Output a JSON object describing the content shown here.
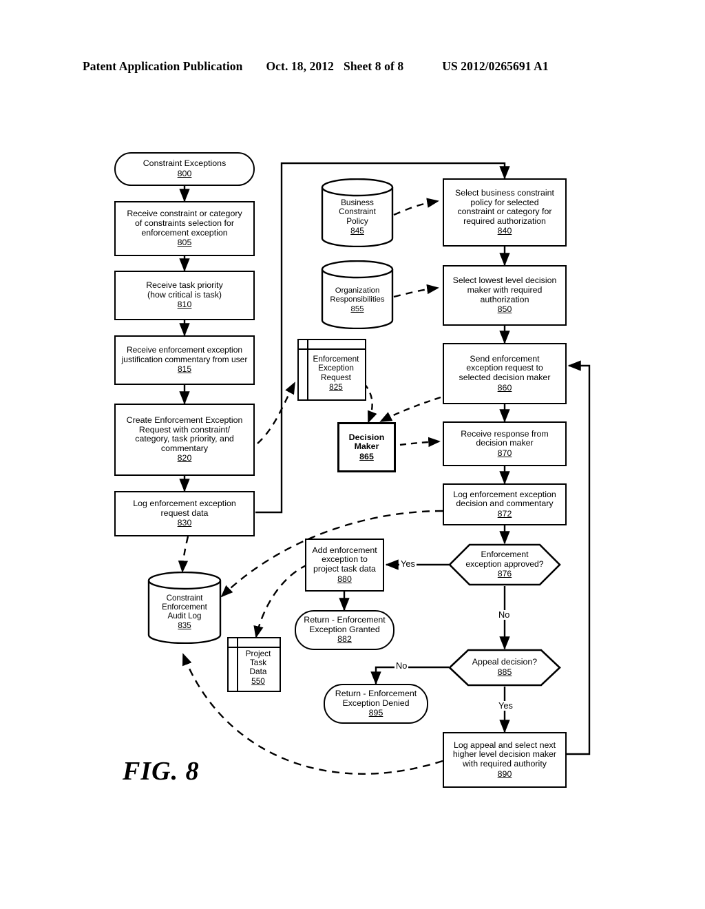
{
  "header": {
    "left": "Patent Application Publication",
    "date": "Oct. 18, 2012",
    "sheet": "Sheet 8 of 8",
    "number": "US 2012/0265691 A1"
  },
  "figure": {
    "label": "FIG. 8"
  },
  "nodes": {
    "n800": {
      "text": "Constraint Exceptions",
      "ref": "800",
      "shape": "terminator"
    },
    "n805": {
      "line1": "Receive constraint or category",
      "line2": "of constraints selection for",
      "line3": "enforcement exception",
      "ref": "805",
      "shape": "process"
    },
    "n810": {
      "line1": "Receive task priority",
      "line2": "(how critical is task)",
      "ref": "810",
      "shape": "process"
    },
    "n815": {
      "line1": "Receive enforcement exception",
      "line2": "justification commentary from user",
      "ref": "815",
      "shape": "process"
    },
    "n820": {
      "line1": "Create Enforcement Exception",
      "line2": "Request with constraint/",
      "line3": "category, task priority, and",
      "line4": "commentary",
      "ref": "820",
      "shape": "process"
    },
    "n830": {
      "line1": "Log enforcement exception",
      "line2": "request data",
      "ref": "830",
      "shape": "process"
    },
    "n835": {
      "line1": "Constraint",
      "line2": "Enforcement",
      "line3": "Audit Log",
      "ref": "835",
      "shape": "cylinder"
    },
    "n845": {
      "line1": "Business",
      "line2": "Constraint",
      "line3": "Policy",
      "ref": "845",
      "shape": "cylinder"
    },
    "n855": {
      "line1": "Organization",
      "line2": "Responsibilities",
      "ref": "855",
      "shape": "cylinder"
    },
    "n825": {
      "line1": "Enforcement",
      "line2": "Exception",
      "line3": "Request",
      "ref": "825",
      "shape": "stacked-document"
    },
    "n865": {
      "line1": "Decision",
      "line2": "Maker",
      "ref": "865",
      "shape": "process-bold"
    },
    "n840": {
      "line1": "Select business constraint",
      "line2": "policy for selected",
      "line3": "constraint or category for",
      "line4": "required authorization",
      "ref": "840",
      "shape": "process"
    },
    "n850": {
      "line1": "Select lowest level decision",
      "line2": "maker with required",
      "line3": "authorization",
      "ref": "850",
      "shape": "process"
    },
    "n860": {
      "line1": "Send enforcement",
      "line2": "exception request to",
      "line3": "selected decision maker",
      "ref": "860",
      "shape": "process"
    },
    "n870": {
      "line1": "Receive response from",
      "line2": "decision maker",
      "ref": "870",
      "shape": "process"
    },
    "n872": {
      "line1": "Log enforcement exception",
      "line2": "decision and commentary",
      "ref": "872",
      "shape": "process"
    },
    "n876": {
      "line1": "Enforcement",
      "line2": "exception approved?",
      "ref": "876",
      "shape": "hexagon"
    },
    "n880": {
      "line1": "Add enforcement",
      "line2": "exception to",
      "line3": "project task data",
      "ref": "880",
      "shape": "process"
    },
    "n882": {
      "line1": "Return - Enforcement",
      "line2": "Exception Granted",
      "ref": "882",
      "shape": "terminator"
    },
    "n885": {
      "text": "Appeal decision?",
      "ref": "885",
      "shape": "hexagon"
    },
    "n890": {
      "line1": "Log appeal and select next",
      "line2": "higher level decision maker",
      "line3": "with required authority",
      "ref": "890",
      "shape": "process"
    },
    "n895": {
      "line1": "Return - Enforcement",
      "line2": "Exception Denied",
      "ref": "895",
      "shape": "terminator"
    },
    "n550": {
      "line1": "Project",
      "line2": "Task",
      "line3": "Data",
      "ref": "550",
      "shape": "stacked-document"
    }
  },
  "edge_labels": {
    "yes_approved": "Yes",
    "no_approved": "No",
    "no_appeal": "No",
    "yes_appeal": "Yes"
  },
  "colors": {
    "ink": "#000000",
    "paper": "#ffffff"
  }
}
